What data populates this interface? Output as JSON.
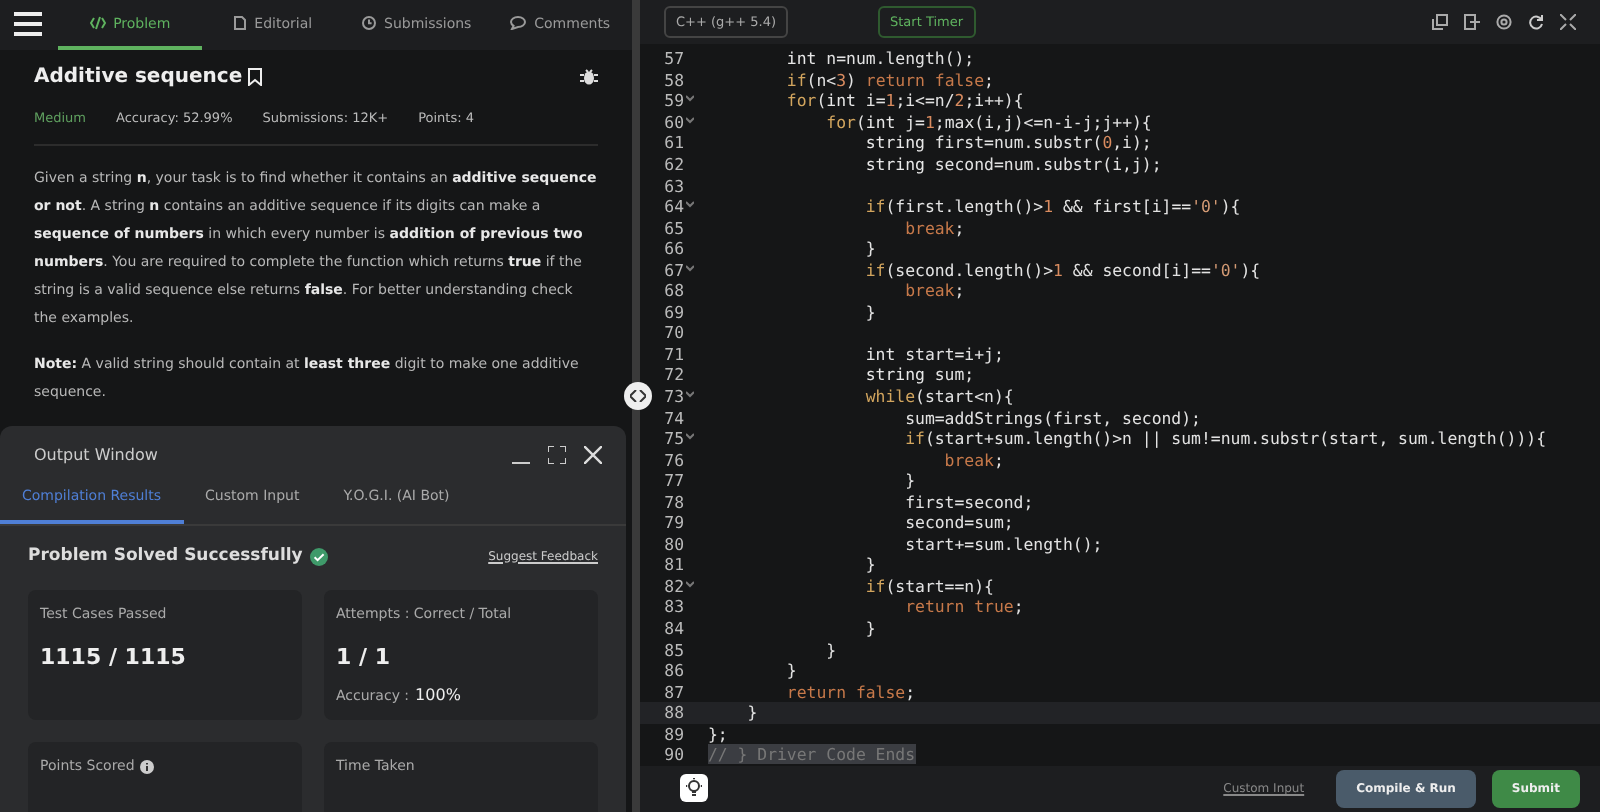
{
  "nav": {
    "tabs": [
      {
        "label": "Problem",
        "selected": true
      },
      {
        "label": "Editorial",
        "selected": false
      },
      {
        "label": "Submissions",
        "selected": false
      },
      {
        "label": "Comments",
        "selected": false
      }
    ]
  },
  "problem": {
    "title": "Additive sequence",
    "difficulty": "Medium",
    "accuracy": "Accuracy: 52.99%",
    "submissions": "Submissions: 12K+",
    "points": "Points: 4",
    "description": "Given a string **n**, your task is to find whether it contains an **additive sequence or not**. A string **n** contains an additive sequence if its digits can make a **sequence of numbers** in which every number is **addition of previous two numbers**. You are required to complete the function which returns **true** if the string is a valid sequence else returns **false**. For better understanding check the examples.",
    "note": "**Note:** A valid string should contain at **least three** digit to make one additive sequence."
  },
  "output": {
    "title": "Output Window",
    "tabs": [
      {
        "label": "Compilation Results",
        "selected": true
      },
      {
        "label": "Custom Input",
        "selected": false
      },
      {
        "label": "Y.O.G.I. (AI Bot)",
        "selected": false
      }
    ],
    "status": "Problem Solved Successfully",
    "feedback": "Suggest Feedback",
    "cards": [
      {
        "label": "Test Cases Passed",
        "value": "1115 / 1115"
      },
      {
        "label": "Attempts : Correct / Total",
        "value": "1 / 1",
        "extra_label": "Accuracy :",
        "extra_value": "100%"
      },
      {
        "label": "Points Scored",
        "info": true
      },
      {
        "label": "Time Taken"
      }
    ]
  },
  "editor": {
    "language": "C++ (g++ 5.4)",
    "timer": "Start Timer",
    "lines": [
      {
        "number": "57",
        "fold": false,
        "current": false,
        "tokens": [
          {
            "kind": "type",
            "text": "        int"
          },
          {
            "kind": "plain",
            "text": " n=num.length();"
          }
        ]
      },
      {
        "number": "58",
        "fold": false,
        "current": false,
        "tokens": [
          {
            "kind": "keyword",
            "text": "        if"
          },
          {
            "kind": "plain",
            "text": "(n<"
          },
          {
            "kind": "number",
            "text": "3"
          },
          {
            "kind": "plain",
            "text": ") "
          },
          {
            "kind": "literal",
            "text": "return false"
          },
          {
            "kind": "plain",
            "text": ";"
          }
        ]
      },
      {
        "number": "59",
        "fold": true,
        "current": false,
        "tokens": [
          {
            "kind": "keyword",
            "text": "        for"
          },
          {
            "kind": "plain",
            "text": "("
          },
          {
            "kind": "type",
            "text": "int"
          },
          {
            "kind": "plain",
            "text": " i="
          },
          {
            "kind": "number",
            "text": "1"
          },
          {
            "kind": "plain",
            "text": ";i<=n/"
          },
          {
            "kind": "number",
            "text": "2"
          },
          {
            "kind": "plain",
            "text": ";i++){"
          }
        ]
      },
      {
        "number": "60",
        "fold": true,
        "current": false,
        "tokens": [
          {
            "kind": "keyword",
            "text": "            for"
          },
          {
            "kind": "plain",
            "text": "("
          },
          {
            "kind": "type",
            "text": "int"
          },
          {
            "kind": "plain",
            "text": " j="
          },
          {
            "kind": "number",
            "text": "1"
          },
          {
            "kind": "plain",
            "text": ";max(i,j)<=n-i-j;j++){"
          }
        ]
      },
      {
        "number": "61",
        "fold": false,
        "current": false,
        "tokens": [
          {
            "kind": "type",
            "text": "                string"
          },
          {
            "kind": "plain",
            "text": " first=num.substr("
          },
          {
            "kind": "number",
            "text": "0"
          },
          {
            "kind": "plain",
            "text": ",i);"
          }
        ]
      },
      {
        "number": "62",
        "fold": false,
        "current": false,
        "tokens": [
          {
            "kind": "type",
            "text": "                string"
          },
          {
            "kind": "plain",
            "text": " second=num.substr(i,j);"
          }
        ]
      },
      {
        "number": "63",
        "fold": false,
        "current": false
      },
      {
        "number": "64",
        "fold": true,
        "current": false,
        "tokens": [
          {
            "kind": "keyword",
            "text": "                if"
          },
          {
            "kind": "plain",
            "text": "(first.length()>"
          },
          {
            "kind": "number",
            "text": "1"
          },
          {
            "kind": "plain",
            "text": " && first[i]=="
          },
          {
            "kind": "string",
            "text": "'0'"
          },
          {
            "kind": "plain",
            "text": "){"
          }
        ]
      },
      {
        "number": "65",
        "fold": false,
        "current": false,
        "tokens": [
          {
            "kind": "literal",
            "text": "                    break"
          },
          {
            "kind": "plain",
            "text": ";"
          }
        ]
      },
      {
        "number": "66",
        "fold": false,
        "current": false,
        "tokens": [
          {
            "kind": "plain",
            "text": "                }"
          }
        ]
      },
      {
        "number": "67",
        "fold": true,
        "current": false,
        "tokens": [
          {
            "kind": "keyword",
            "text": "                if"
          },
          {
            "kind": "plain",
            "text": "(second.length()>"
          },
          {
            "kind": "number",
            "text": "1"
          },
          {
            "kind": "plain",
            "text": " && second[i]=="
          },
          {
            "kind": "string",
            "text": "'0'"
          },
          {
            "kind": "plain",
            "text": "){"
          }
        ]
      },
      {
        "number": "68",
        "fold": false,
        "current": false,
        "tokens": [
          {
            "kind": "literal",
            "text": "                    break"
          },
          {
            "kind": "plain",
            "text": ";"
          }
        ]
      },
      {
        "number": "69",
        "fold": false,
        "current": false,
        "tokens": [
          {
            "kind": "plain",
            "text": "                }"
          }
        ]
      },
      {
        "number": "70",
        "fold": false,
        "current": false
      },
      {
        "number": "71",
        "fold": false,
        "current": false,
        "tokens": [
          {
            "kind": "type",
            "text": "                int"
          },
          {
            "kind": "plain",
            "text": " start=i+j;"
          }
        ]
      },
      {
        "number": "72",
        "fold": false,
        "current": false,
        "tokens": [
          {
            "kind": "type",
            "text": "                string"
          },
          {
            "kind": "plain",
            "text": " sum;"
          }
        ]
      },
      {
        "number": "73",
        "fold": true,
        "current": false,
        "tokens": [
          {
            "kind": "keyword",
            "text": "                while"
          },
          {
            "kind": "plain",
            "text": "(start<n){"
          }
        ]
      },
      {
        "number": "74",
        "fold": false,
        "current": false,
        "tokens": [
          {
            "kind": "plain",
            "text": "                    sum=addStrings(first, second);"
          }
        ]
      },
      {
        "number": "75",
        "fold": true,
        "current": false,
        "tokens": [
          {
            "kind": "keyword",
            "text": "                    if"
          },
          {
            "kind": "plain",
            "text": "(start+sum.length()>n || sum!=num.substr(start, sum.length())){"
          }
        ]
      },
      {
        "number": "76",
        "fold": false,
        "current": false,
        "tokens": [
          {
            "kind": "literal",
            "text": "                        break"
          },
          {
            "kind": "plain",
            "text": ";"
          }
        ]
      },
      {
        "number": "77",
        "fold": false,
        "current": false,
        "tokens": [
          {
            "kind": "plain",
            "text": "                    }"
          }
        ]
      },
      {
        "number": "78",
        "fold": false,
        "current": false,
        "tokens": [
          {
            "kind": "plain",
            "text": "                    first=second;"
          }
        ]
      },
      {
        "number": "79",
        "fold": false,
        "current": false,
        "tokens": [
          {
            "kind": "plain",
            "text": "                    second=sum;"
          }
        ]
      },
      {
        "number": "80",
        "fold": false,
        "current": false,
        "tokens": [
          {
            "kind": "plain",
            "text": "                    start+=sum.length();"
          }
        ]
      },
      {
        "number": "81",
        "fold": false,
        "current": false,
        "tokens": [
          {
            "kind": "plain",
            "text": "                }"
          }
        ]
      },
      {
        "number": "82",
        "fold": true,
        "current": false,
        "tokens": [
          {
            "kind": "keyword",
            "text": "                if"
          },
          {
            "kind": "plain",
            "text": "(start==n){"
          }
        ]
      },
      {
        "number": "83",
        "fold": false,
        "current": false,
        "tokens": [
          {
            "kind": "literal",
            "text": "                    return true"
          },
          {
            "kind": "plain",
            "text": ";"
          }
        ]
      },
      {
        "number": "84",
        "fold": false,
        "current": false,
        "tokens": [
          {
            "kind": "plain",
            "text": "                }"
          }
        ]
      },
      {
        "number": "85",
        "fold": false,
        "current": false,
        "tokens": [
          {
            "kind": "plain",
            "text": "            }"
          }
        ]
      },
      {
        "number": "86",
        "fold": false,
        "current": false,
        "tokens": [
          {
            "kind": "plain",
            "text": "        }"
          }
        ]
      },
      {
        "number": "87",
        "fold": false,
        "current": false,
        "tokens": [
          {
            "kind": "literal",
            "text": "        return false"
          },
          {
            "kind": "plain",
            "text": ";"
          }
        ]
      },
      {
        "number": "88",
        "fold": false,
        "current": true,
        "tokens": [
          {
            "kind": "plain",
            "text": "    }"
          }
        ]
      },
      {
        "number": "89",
        "fold": false,
        "current": false,
        "tokens": [
          {
            "kind": "plain",
            "text": "};"
          }
        ]
      },
      {
        "number": "90",
        "fold": false,
        "current": false,
        "tokens": [
          {
            "kind": "comment",
            "text": "// } Driver Code Ends"
          }
        ]
      }
    ],
    "footer": {
      "custom_input": "Custom Input",
      "compile": "Compile & Run",
      "submit": "Submit"
    }
  }
}
